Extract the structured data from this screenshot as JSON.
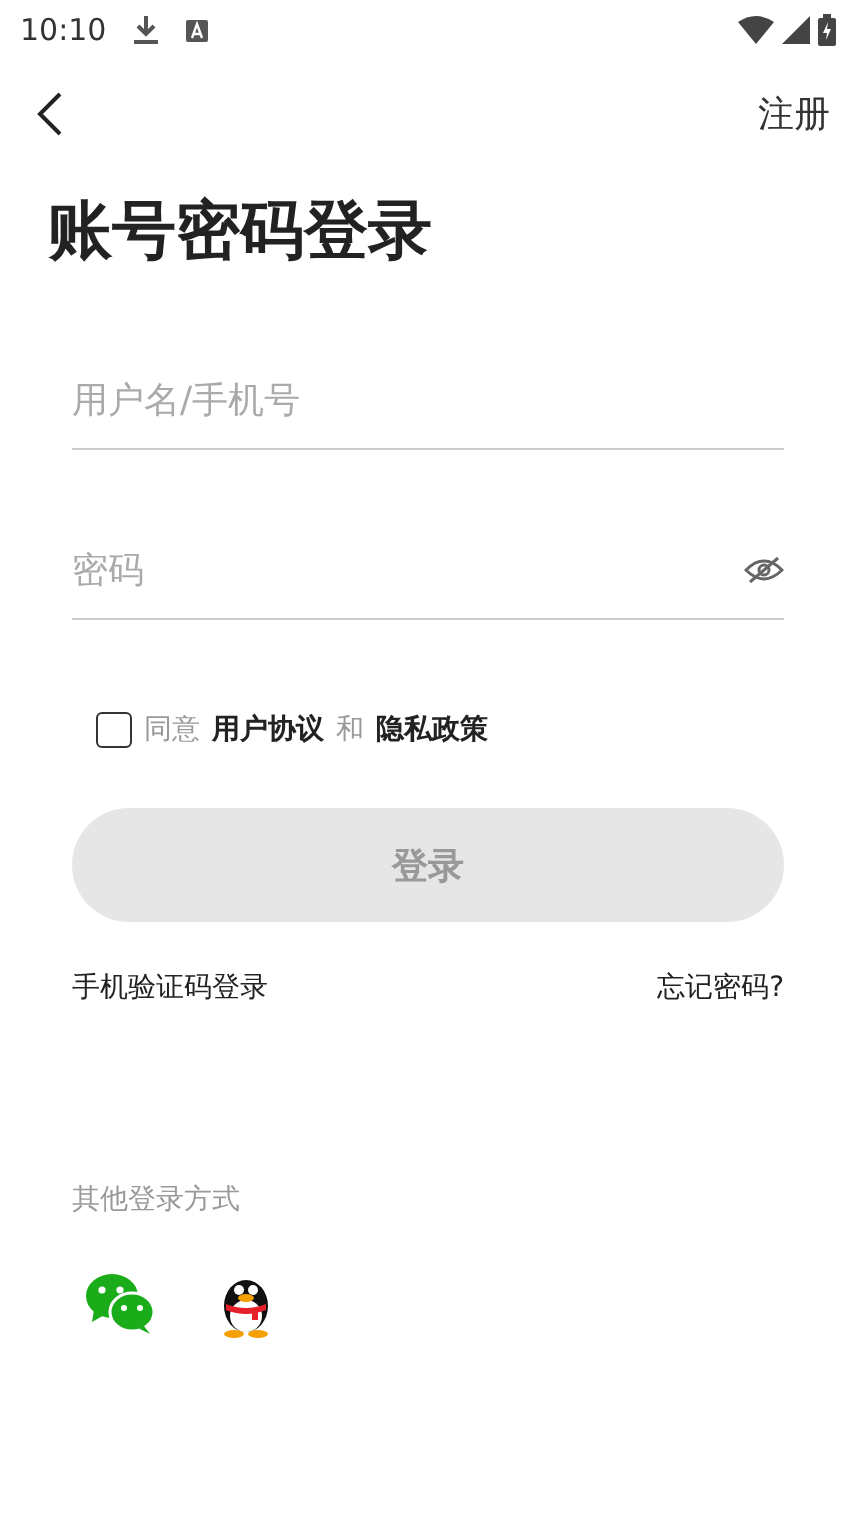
{
  "status_bar": {
    "time": "10:10"
  },
  "header": {
    "action": "注册"
  },
  "title": "账号密码登录",
  "fields": [
    {
      "kind": "text",
      "placeholder": "用户名/手机号"
    },
    {
      "kind": "password",
      "placeholder": "密码"
    }
  ],
  "agreement": {
    "checked": false,
    "parts": [
      {
        "kind": "text",
        "text": "同意"
      },
      {
        "kind": "link",
        "text": "用户协议"
      },
      {
        "kind": "text",
        "text": "和"
      },
      {
        "kind": "link",
        "text": "隐私政策"
      }
    ]
  },
  "login_button": {
    "label": "登录",
    "disabled": true
  },
  "links": [
    "手机验证码登录",
    "忘记密码?"
  ],
  "other": {
    "label": "其他登录方式",
    "methods": [
      {
        "kind": "chat"
      },
      {
        "kind": "penguin"
      }
    ]
  }
}
